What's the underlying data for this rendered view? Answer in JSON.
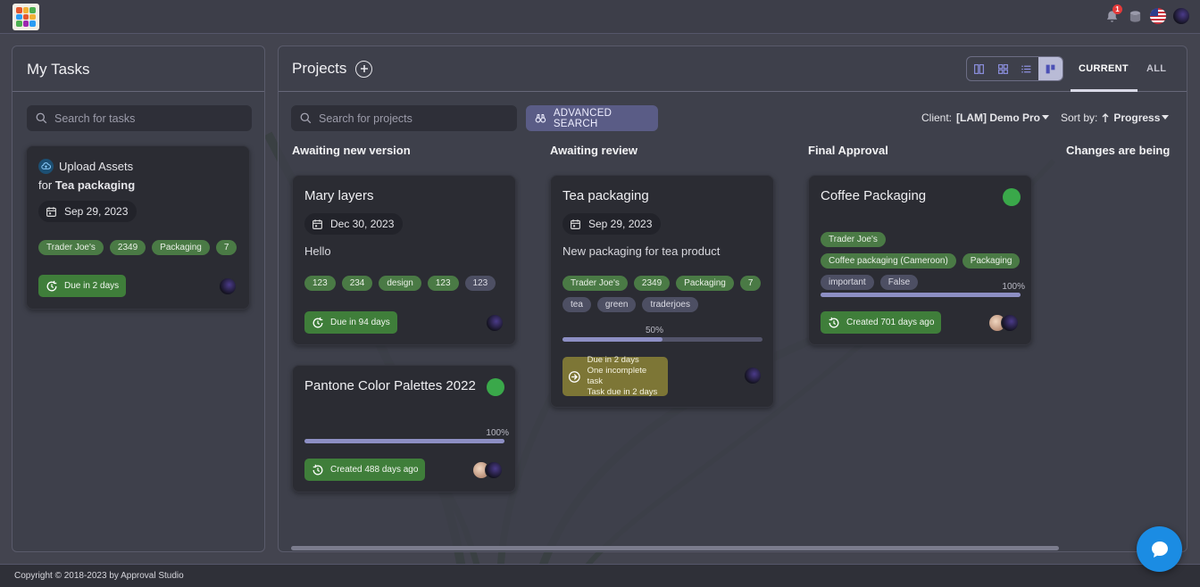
{
  "topbar": {
    "notification_count": "1",
    "icons": [
      "bell-icon",
      "database-icon",
      "us-flag-icon",
      "user-avatar"
    ]
  },
  "my_tasks": {
    "title": "My Tasks",
    "search_placeholder": "Search for tasks",
    "task": {
      "title": "Upload Assets",
      "for_prefix": "for",
      "project": "Tea packaging",
      "date": "Sep 29, 2023",
      "tags": [
        "Trader Joe's",
        "2349",
        "Packaging",
        "7"
      ],
      "due": "Due in 2 days"
    }
  },
  "projects": {
    "title": "Projects",
    "search_placeholder": "Search for projects",
    "advanced_search": "ADVANCED SEARCH",
    "client_label": "Client:",
    "client_value": "[LAM] Demo Pro",
    "sort_label": "Sort by:",
    "sort_value": "Progress",
    "tabs": {
      "current": "CURRENT",
      "all": "ALL"
    },
    "columns": [
      "Awaiting new version",
      "Awaiting review",
      "Final Approval",
      "Changes are being a"
    ],
    "cards": {
      "mary": {
        "title": "Mary layers",
        "date": "Dec 30, 2023",
        "description": "Hello",
        "tags": [
          "123",
          "234",
          "design",
          "123",
          "123"
        ],
        "due": "Due in 94 days"
      },
      "pantone": {
        "title": "Pantone Color Palettes 2022",
        "progress": 100,
        "progress_label": "100%",
        "created": "Created 488 days ago",
        "status_color": "#3aa84a"
      },
      "tea": {
        "title": "Tea packaging",
        "date": "Sep 29, 2023",
        "description": "New packaging for tea product",
        "tags_green": [
          "Trader Joe's",
          "2349",
          "Packaging",
          "7"
        ],
        "tags_slate": [
          "tea",
          "green",
          "traderjoes"
        ],
        "progress": 50,
        "progress_label": "50%",
        "due_line1": "Due in 2 days",
        "due_line2": "One incomplete task",
        "due_line3": "Task due in 2 days"
      },
      "coffee": {
        "title": "Coffee Packaging",
        "tags_green": [
          "Trader Joe's",
          "Coffee packaging (Cameroon)",
          "Packaging"
        ],
        "tags_slate": [
          "important",
          "False"
        ],
        "progress": 100,
        "progress_label": "100%",
        "created": "Created 701 days ago",
        "status_color": "#3aa84a"
      }
    }
  },
  "footer": {
    "copyright": "Copyright © 2018-2023 by Approval Studio"
  },
  "colors": {
    "accent": "#5a5c86",
    "green": "#3f7e3a",
    "chat": "#1b8ce3"
  }
}
